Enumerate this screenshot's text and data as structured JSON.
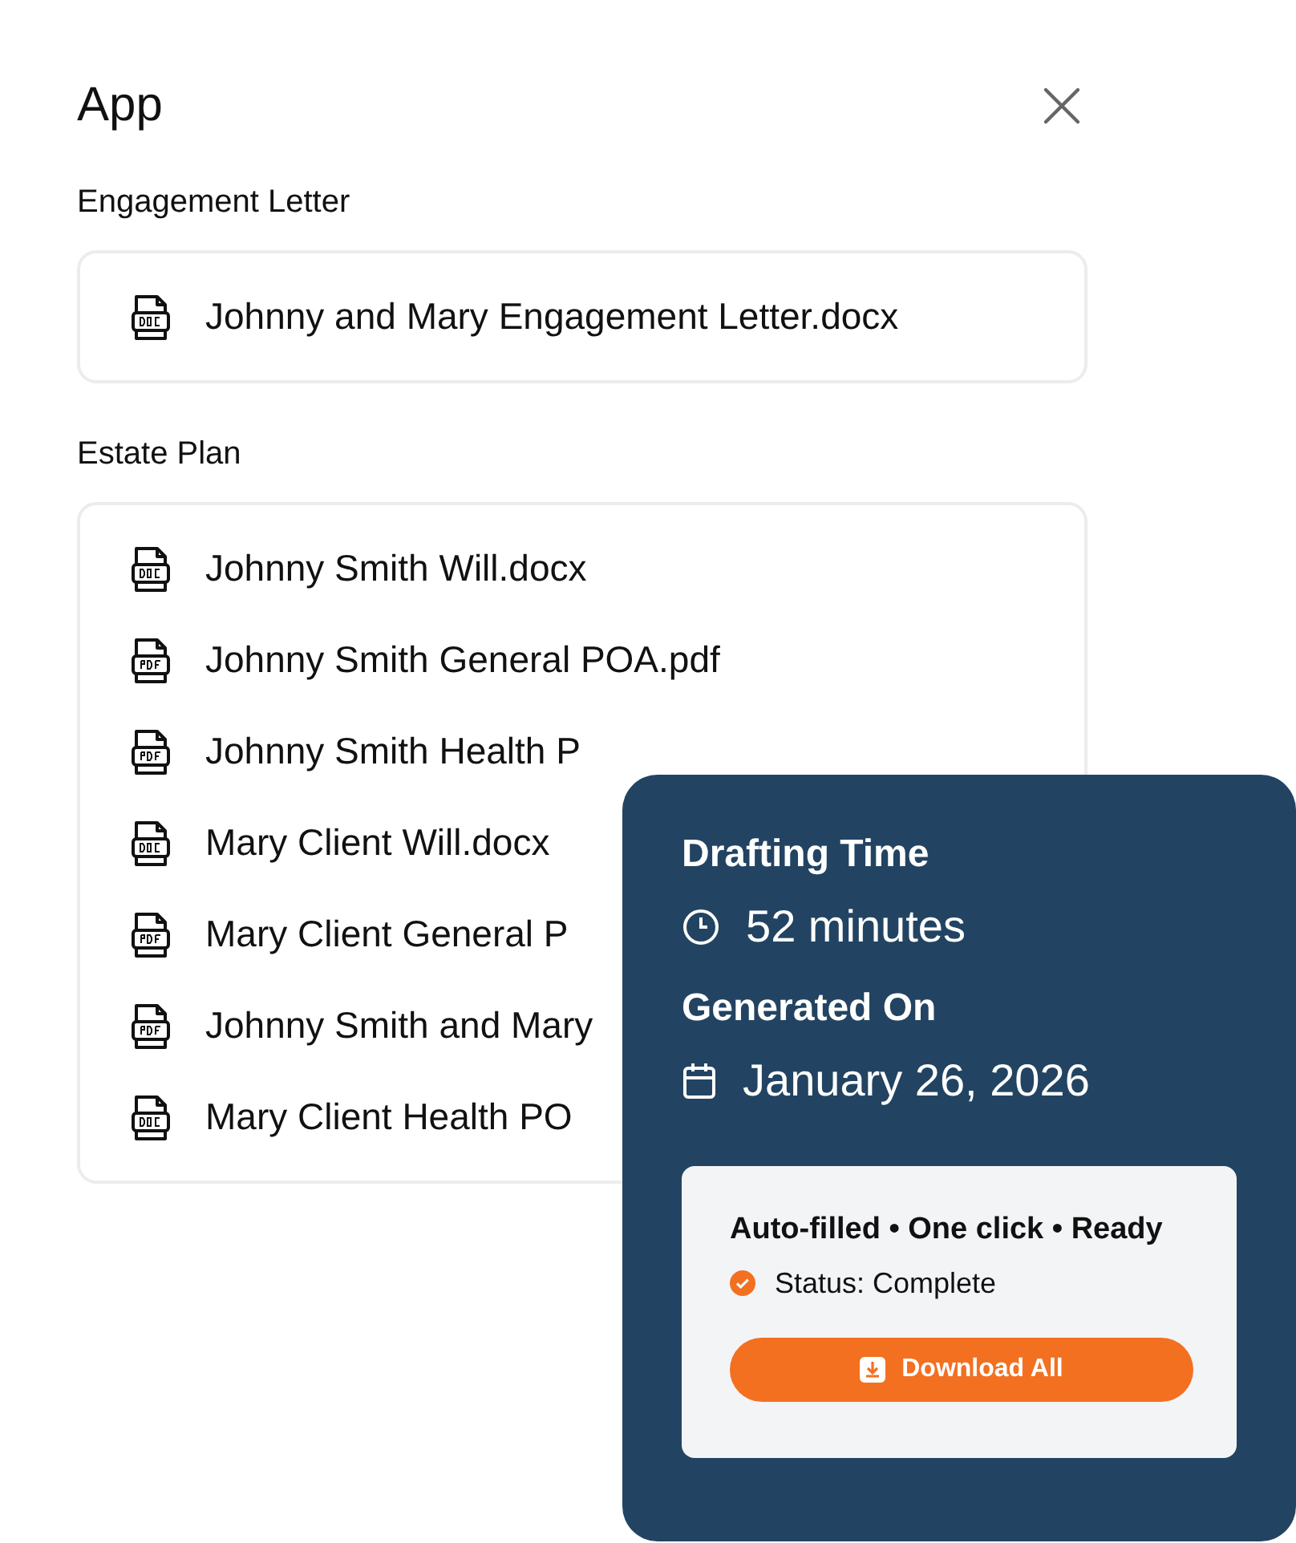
{
  "window": {
    "title": "App"
  },
  "sections": [
    {
      "title": "Engagement Letter",
      "files": [
        {
          "name": "Johnny and Mary Engagement Letter.docx",
          "kind": "doc"
        }
      ]
    },
    {
      "title": "Estate Plan",
      "files": [
        {
          "name": "Johnny Smith Will.docx",
          "kind": "doc"
        },
        {
          "name": "Johnny Smith General POA.pdf",
          "kind": "pdf"
        },
        {
          "name": "Johnny Smith Health P",
          "kind": "pdf"
        },
        {
          "name": "Mary Client Will.docx",
          "kind": "doc"
        },
        {
          "name": "Mary Client General P",
          "kind": "pdf"
        },
        {
          "name": "Johnny Smith and Mary",
          "kind": "pdf"
        },
        {
          "name": "Mary Client Health PO",
          "kind": "doc"
        }
      ]
    }
  ],
  "summary": {
    "drafting_label": "Drafting Time",
    "drafting_value": "52 minutes",
    "generated_label": "Generated On",
    "generated_value": "January 26, 2026",
    "tagline": "Auto-filled • One click • Ready",
    "status": "Status: Complete",
    "button": "Download All"
  }
}
